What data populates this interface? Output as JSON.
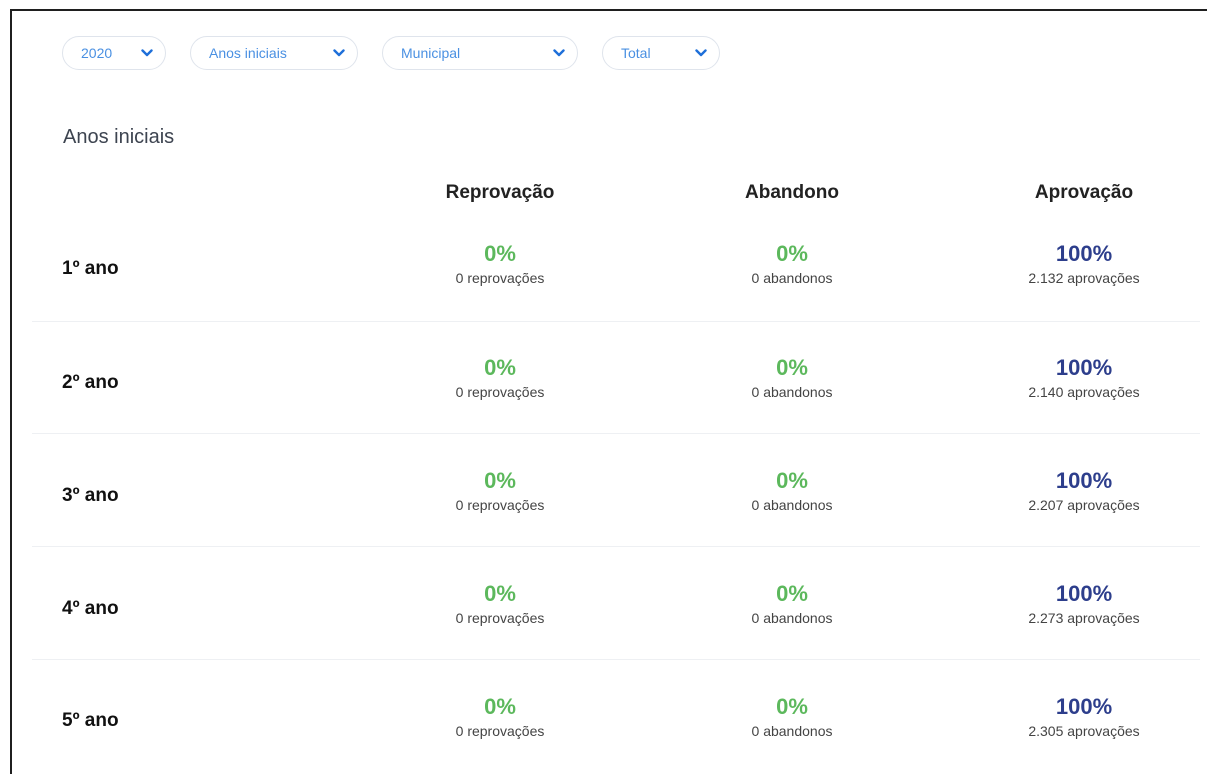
{
  "filters": [
    {
      "label": "2020"
    },
    {
      "label": "Anos iniciais"
    },
    {
      "label": "Municipal"
    },
    {
      "label": "Total"
    }
  ],
  "section_title": "Anos iniciais",
  "columns": [
    "Reprovação",
    "Abandono",
    "Aprovação"
  ],
  "colors": {
    "green": "#5cb85c",
    "navy": "#2d3e8c",
    "filter_text": "#4a90e2"
  },
  "rows": [
    {
      "label": "1º ano",
      "reprovacao": {
        "pct": "0%",
        "sub": "0 reprovações"
      },
      "abandono": {
        "pct": "0%",
        "sub": "0 abandonos"
      },
      "aprovacao": {
        "pct": "100%",
        "sub": "2.132 aprovações"
      }
    },
    {
      "label": "2º ano",
      "reprovacao": {
        "pct": "0%",
        "sub": "0 reprovações"
      },
      "abandono": {
        "pct": "0%",
        "sub": "0 abandonos"
      },
      "aprovacao": {
        "pct": "100%",
        "sub": "2.140 aprovações"
      }
    },
    {
      "label": "3º ano",
      "reprovacao": {
        "pct": "0%",
        "sub": "0 reprovações"
      },
      "abandono": {
        "pct": "0%",
        "sub": "0 abandonos"
      },
      "aprovacao": {
        "pct": "100%",
        "sub": "2.207 aprovações"
      }
    },
    {
      "label": "4º ano",
      "reprovacao": {
        "pct": "0%",
        "sub": "0 reprovações"
      },
      "abandono": {
        "pct": "0%",
        "sub": "0 abandonos"
      },
      "aprovacao": {
        "pct": "100%",
        "sub": "2.273 aprovações"
      }
    },
    {
      "label": "5º ano",
      "reprovacao": {
        "pct": "0%",
        "sub": "0 reprovações"
      },
      "abandono": {
        "pct": "0%",
        "sub": "0 abandonos"
      },
      "aprovacao": {
        "pct": "100%",
        "sub": "2.305 aprovações"
      }
    }
  ]
}
